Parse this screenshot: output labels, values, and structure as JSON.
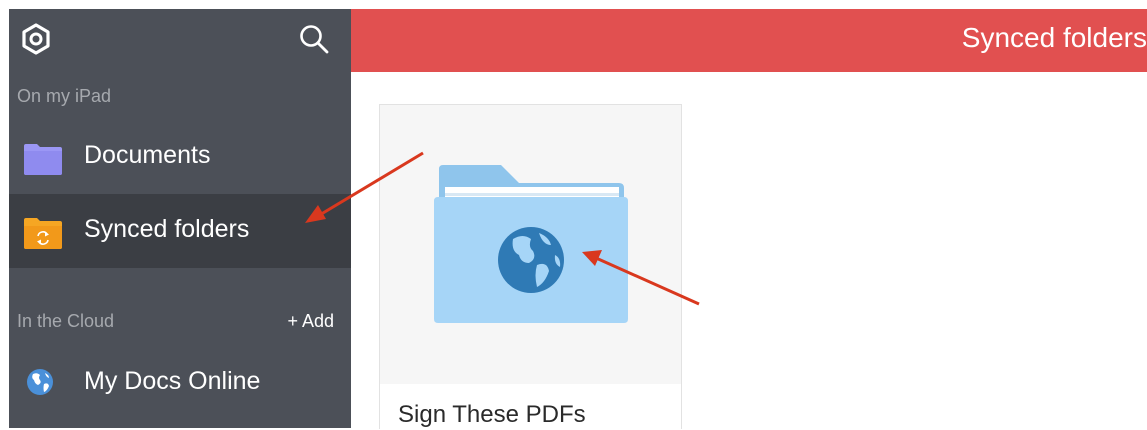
{
  "sidebar": {
    "settings_icon": "gear-icon",
    "search_icon": "search-icon",
    "section_local": "On my iPad",
    "items_local": [
      {
        "label": "Documents",
        "icon": "folder-icon",
        "color": "#9b97f5"
      },
      {
        "label": "Synced folders",
        "icon": "synced-folder-icon",
        "color": "#f6a623",
        "selected": true
      }
    ],
    "section_cloud": "In the Cloud",
    "add_label": "+ Add",
    "items_cloud": [
      {
        "label": "My Docs Online",
        "icon": "globe-icon",
        "color": "#4a90d9"
      }
    ]
  },
  "header": {
    "title": "Synced folders",
    "color": "#e15050"
  },
  "content": {
    "folders": [
      {
        "name": "Sign These PDFs",
        "icon": "globe-folder-icon",
        "color": "#a6d5f7"
      }
    ]
  },
  "annotations": {
    "arrow_color": "#d9381e"
  }
}
